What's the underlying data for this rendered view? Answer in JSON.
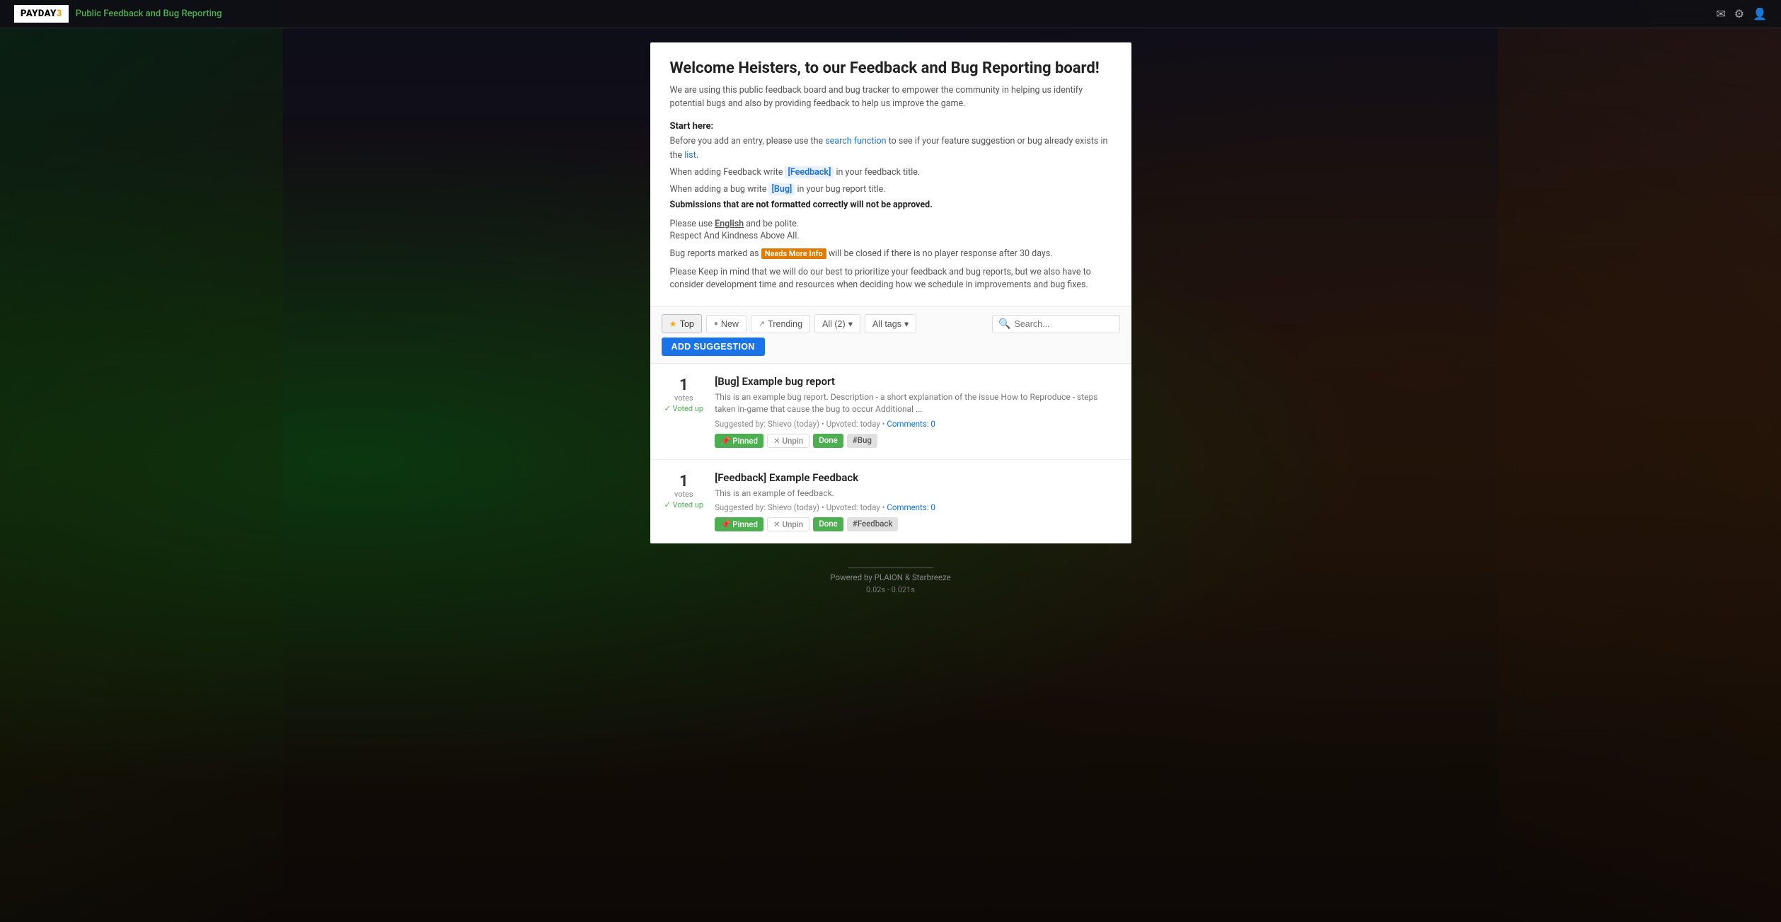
{
  "navbar": {
    "logo_text": "PAYDAY",
    "logo_number": "3",
    "site_title": "Public Feedback and Bug Reporting"
  },
  "welcome": {
    "title": "Welcome Heisters, to our Feedback and Bug Reporting board!",
    "description": "We are using this public feedback board and bug tracker to empower the community in helping us identify potential bugs and also by providing feedback to help us improve the game.",
    "start_here_label": "Start here:",
    "search_instruction": "Before you add an entry, please use the search function to see if your feature suggestion or bug already exists in the list.",
    "feedback_instruction": "When adding Feedback write [Feedback] in your feedback title.",
    "bug_instruction": "When adding a bug write [Bug] in your bug report title.",
    "format_warning": "Submissions that are not formatted correctly will not be approved.",
    "lang_instruction_1": "Please use English and be polite.",
    "lang_instruction_2": "Respect And Kindness Above All.",
    "needs_more_info_note": "Bug reports marked as Needs More Info will be closed if there is no player response after 30 days.",
    "dev_note": "Please Keep in mind that we will do our best to prioritize your feedback and bug reports, but we also have to consider development time and resources when deciding how we schedule in improvements and bug fixes."
  },
  "filters": {
    "top_label": "Top",
    "new_label": "New",
    "trending_label": "Trending",
    "all_label": "All (2)",
    "all_tags_label": "All tags",
    "search_placeholder": "Search...",
    "add_btn_label": "ADD SUGGESTION"
  },
  "posts": [
    {
      "id": 1,
      "vote_count": "1",
      "votes_label": "votes",
      "voted_up_label": "Voted up",
      "title": "[Bug] Example bug report",
      "excerpt": "This is an example bug report. Description - a short explanation of the issue How to Reproduce - steps taken in-game that cause the bug to occur Additional ...",
      "suggested_by": "Shievo",
      "suggested_when": "today",
      "upvoted_when": "today",
      "comments_count": "0",
      "comments_label": "Comments: 0",
      "tags": [
        {
          "type": "pinned",
          "label": "📌 Pinned"
        },
        {
          "type": "unpin",
          "label": "✕ Unpin"
        },
        {
          "type": "done",
          "label": "Done"
        },
        {
          "type": "bug",
          "label": "#Bug"
        }
      ]
    },
    {
      "id": 2,
      "vote_count": "1",
      "votes_label": "votes",
      "voted_up_label": "Voted up",
      "title": "[Feedback] Example Feedback",
      "excerpt": "This is an example of feedback.",
      "suggested_by": "Shievo",
      "suggested_when": "today",
      "upvoted_when": "today",
      "comments_count": "0",
      "comments_label": "Comments: 0",
      "tags": [
        {
          "type": "pinned",
          "label": "📌 Pinned"
        },
        {
          "type": "unpin",
          "label": "✕ Unpin"
        },
        {
          "type": "done",
          "label": "Done"
        },
        {
          "type": "feedback",
          "label": "#Feedback"
        }
      ]
    }
  ],
  "footer": {
    "powered_by": "Powered by PLAION & Starbreeze",
    "timing": "0.02s - 0.021s"
  }
}
